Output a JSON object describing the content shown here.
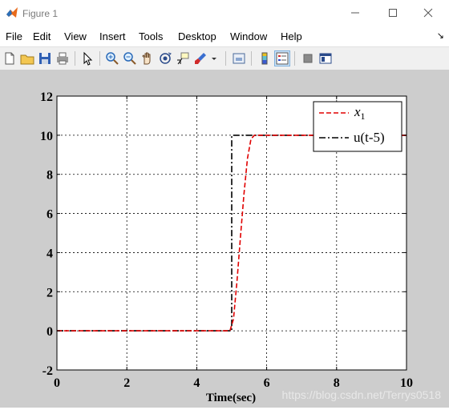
{
  "window": {
    "title": "Figure 1"
  },
  "menu": {
    "items": [
      "File",
      "Edit",
      "View",
      "Insert",
      "Tools",
      "Desktop",
      "Window",
      "Help"
    ],
    "overflow_arrow": "↘"
  },
  "toolbar": {
    "icons": [
      "new-figure-icon",
      "open-file-icon",
      "save-icon",
      "print-icon",
      "pointer-icon",
      "zoom-in-icon",
      "zoom-out-icon",
      "pan-hand-icon",
      "rotate-3d-icon",
      "data-cursor-icon",
      "brush-icon",
      "link-plot-icon",
      "colorbar-icon",
      "legend-icon",
      "hide-plot-tools-icon",
      "show-plot-tools-icon"
    ]
  },
  "chart_data": {
    "type": "line",
    "xlabel": "Time(sec)",
    "ylabel": "",
    "xlim": [
      0,
      10
    ],
    "ylim": [
      -2,
      12
    ],
    "xticks": [
      "0",
      "2",
      "4",
      "6",
      "8",
      "10"
    ],
    "yticks": [
      "-2",
      "0",
      "2",
      "4",
      "6",
      "8",
      "10",
      "12"
    ],
    "grid": true,
    "legend_position": "top-right",
    "series": [
      {
        "name": "x",
        "name_subscript": "1",
        "color": "#e00000",
        "style": "dashed",
        "x": [
          0,
          4.95,
          5.05,
          5.15,
          5.25,
          5.35,
          5.45,
          5.55,
          5.65,
          10
        ],
        "y": [
          0,
          0,
          0.6,
          2.5,
          4.8,
          7.0,
          8.8,
          9.8,
          10,
          10
        ]
      },
      {
        "name": "u(t-5)",
        "color": "#000000",
        "style": "dashdot",
        "x": [
          0,
          5,
          5,
          10
        ],
        "y": [
          0,
          0,
          10,
          10
        ]
      }
    ]
  },
  "watermark": {
    "text": "https://blog.csdn.net/Terrys0518"
  }
}
